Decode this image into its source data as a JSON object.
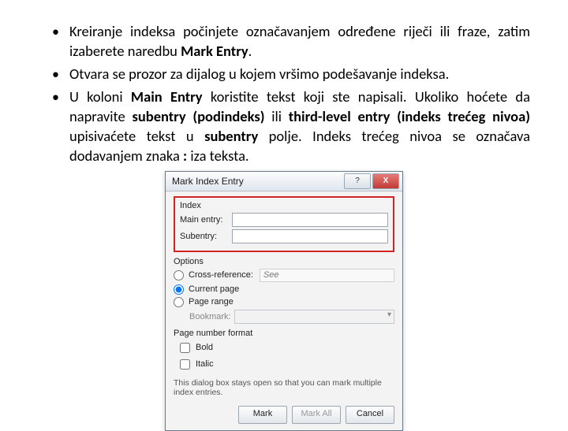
{
  "bullets": {
    "b1_pre": "Kreiranje indeksa počinjete označavanjem određene riječi ili fraze, zatim izaberete naredbu ",
    "b1_bold": "Mark Entry",
    "b1_post": ".",
    "b2": "Otvara se prozor za dijalog u kojem vršimo podešavanje indeksa.",
    "b3_p1": "U koloni ",
    "b3_b1": "Main Entry",
    "b3_p2": " koristite tekst koji ste napisali. Ukoliko hoćete da napravite ",
    "b3_b2": "subentry (podindeks)",
    "b3_p3": " ili ",
    "b3_b3": "third-level entry (indeks trećeg nivoa)",
    "b3_p4": " upisivaćete tekst u ",
    "b3_b4": "subentry",
    "b3_p5": " polje. Indeks trećeg nivoa se označava dodavanjem znaka ",
    "b3_b5": ":",
    "b3_p6": " iza teksta."
  },
  "dialog": {
    "title": "Mark Index Entry",
    "index_label": "Index",
    "main_entry_label": "Main entry:",
    "subentry_label": "Subentry:",
    "options_label": "Options",
    "cross_ref_label": "Cross-reference:",
    "cross_ref_value": "See",
    "current_page_label": "Current page",
    "page_range_label": "Page range",
    "bookmark_label": "Bookmark:",
    "page_fmt_label": "Page number format",
    "bold_label": "Bold",
    "italic_label": "Italic",
    "hint": "This dialog box stays open so that you can mark multiple index entries.",
    "btn_mark": "Mark",
    "btn_mark_all": "Mark All",
    "btn_cancel": "Cancel",
    "help_glyph": "?",
    "close_glyph": "X"
  }
}
